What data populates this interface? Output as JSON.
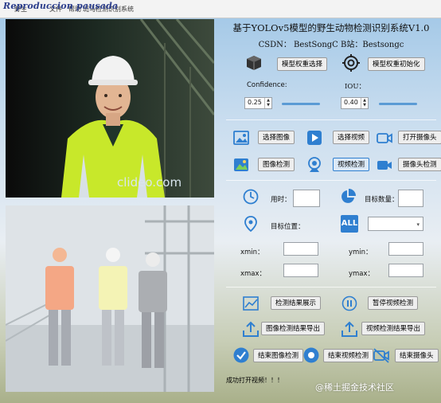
{
  "titlebar": {
    "overlay_text": "Reproduccion pausada",
    "menu": [
      "野生",
      "文件",
      "帮助",
      "斑马检测识别系统"
    ]
  },
  "video": {
    "watermark": "clideo.com"
  },
  "panel": {
    "title": "基于YOLOv5模型的野生动物检测识别系统V1.0",
    "subtitle": "CSDN： BestSongC   B站：Bestsongc",
    "model_select_label": "模型权重选择",
    "model_init_label": "模型权重初始化",
    "confidence_label": "Confidence:",
    "confidence_value": "0.25",
    "iou_label": "IOU：",
    "iou_value": "0.40",
    "select_image_label": "选择图像",
    "select_video_label": "选择视频",
    "open_camera_label": "打开摄像头",
    "image_detect_label": "图像检测",
    "video_detect_label": "视频检测",
    "camera_detect_label": "摄像头检测",
    "time_label": "用时：",
    "target_count_label": "目标数量：",
    "target_pos_label": "目标位置：",
    "xmin_label": "xmin：",
    "ymin_label": "ymin：",
    "xmax_label": "xmax：",
    "ymax_label": "ymax：",
    "show_results_label": "检测结果展示",
    "pause_video_label": "暂停视频检测",
    "export_image_label": "图像检测结果导出",
    "export_video_label": "视频检测结果导出",
    "end_image_label": "结束图像检测",
    "end_video_label": "结束视频检测",
    "end_camera_label": "结束摄像头",
    "all_icon_text": "ALL"
  },
  "status": {
    "message": "成功打开视频！！！",
    "watermark": "@稀土掘金技术社区"
  },
  "colors": {
    "accent": "#2f7fd0",
    "slider": "#5b9bd5"
  }
}
